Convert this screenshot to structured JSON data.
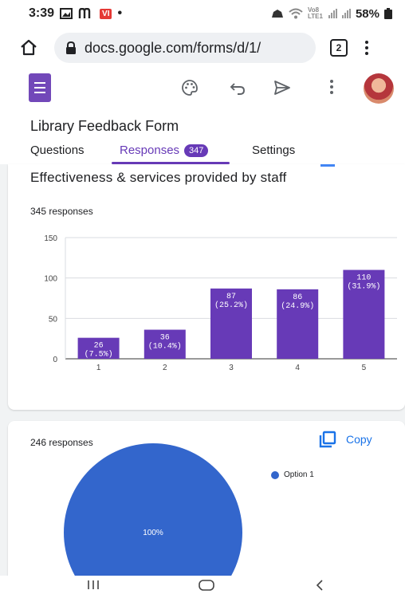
{
  "status_bar": {
    "time": "3:39",
    "carrier_badge": "VI",
    "network_label": "Vo8 LTE1",
    "battery": "58%"
  },
  "browser": {
    "url": "docs.google.com/forms/d/1/",
    "tab_count": "2"
  },
  "form": {
    "title": "Library Feedback Form",
    "tabs": [
      {
        "label": "Questions"
      },
      {
        "label": "Responses",
        "badge": "347"
      },
      {
        "label": "Settings"
      }
    ]
  },
  "question_card": {
    "title": "Effectiveness & services provided by staff",
    "responses": "345 responses"
  },
  "chart_data": [
    {
      "type": "bar",
      "title": "Effectiveness & services provided by staff",
      "categories": [
        "1",
        "2",
        "3",
        "4",
        "5"
      ],
      "values": [
        26,
        36,
        87,
        86,
        110
      ],
      "data_labels": [
        [
          "26",
          "(7.5%)"
        ],
        [
          "36",
          "(10.4%)"
        ],
        [
          "87",
          "(25.2%)"
        ],
        [
          "86",
          "(24.9%)"
        ],
        [
          "110",
          "(31.9%)"
        ]
      ],
      "yticks": [
        0,
        50,
        100,
        150
      ],
      "ylim": [
        0,
        150
      ],
      "grid": true,
      "color": "#673ab7"
    },
    {
      "type": "pie",
      "categories": [
        "Option 1"
      ],
      "values": [
        100
      ],
      "data_labels": [
        "100%"
      ],
      "legend": "top-right",
      "color": "#3366cc"
    }
  ],
  "second_card": {
    "responses": "246 responses",
    "copy_label": "Copy"
  },
  "colors": {
    "accent": "#673ab7",
    "link_blue": "#1a73e8",
    "pie_blue": "#3366cc"
  }
}
